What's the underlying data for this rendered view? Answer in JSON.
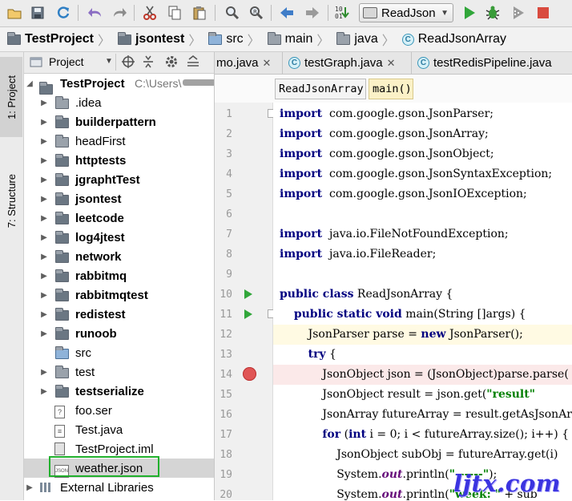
{
  "toolbar": {
    "run_config": "ReadJson",
    "icons": [
      "open-folder-icon",
      "save-icon",
      "sync-icon",
      "undo-icon",
      "redo-icon",
      "cut-icon",
      "copy-icon",
      "paste-icon",
      "find-icon",
      "replace-icon",
      "back-icon",
      "forward-icon",
      "build-icon",
      "run-icon",
      "debug-icon",
      "coverage-icon",
      "stop-icon"
    ]
  },
  "breadcrumb": [
    "TestProject",
    "jsontest",
    "src",
    "main",
    "java",
    "ReadJsonArray"
  ],
  "left_strip": {
    "project_tab": "1: Project",
    "structure_tab": "7: Structure"
  },
  "project_panel": {
    "view": "Project",
    "root": {
      "label": "TestProject",
      "path": "C:\\Users\\"
    },
    "items": [
      {
        "label": ".idea",
        "bold": false
      },
      {
        "label": "builderpattern",
        "bold": true
      },
      {
        "label": "headFirst",
        "bold": false
      },
      {
        "label": "httptests",
        "bold": true
      },
      {
        "label": "jgraphtTest",
        "bold": true
      },
      {
        "label": "jsontest",
        "bold": true
      },
      {
        "label": "leetcode",
        "bold": true
      },
      {
        "label": "log4jtest",
        "bold": true
      },
      {
        "label": "network",
        "bold": true
      },
      {
        "label": "rabbitmq",
        "bold": true
      },
      {
        "label": "rabbitmqtest",
        "bold": true
      },
      {
        "label": "redistest",
        "bold": true
      },
      {
        "label": "runoob",
        "bold": true
      },
      {
        "label": "src",
        "bold": false
      },
      {
        "label": "test",
        "bold": false
      },
      {
        "label": "testserialize",
        "bold": true
      },
      {
        "label": "foo.ser",
        "bold": false
      },
      {
        "label": "Test.java",
        "bold": false
      },
      {
        "label": "TestProject.iml",
        "bold": false
      },
      {
        "label": "weather.json",
        "bold": false
      },
      {
        "label": "External Libraries",
        "bold": false
      }
    ]
  },
  "editor_tabs": [
    {
      "label": "mo.java"
    },
    {
      "label": "testGraph.java"
    },
    {
      "label": "testRedisPipeline.java"
    }
  ],
  "editor_crumbs": [
    "ReadJsonArray",
    "main()"
  ],
  "code": {
    "line_numbers": [
      "1",
      "2",
      "3",
      "4",
      "5",
      "6",
      "7",
      "8",
      "9",
      "10",
      "11",
      "12",
      "13",
      "14",
      "15",
      "16",
      "17",
      "18",
      "19",
      "20"
    ],
    "lines": [
      [
        [
          "kw",
          "import"
        ],
        [
          "",
          "  com.google.gson.JsonParser;"
        ]
      ],
      [
        [
          "kw",
          "import"
        ],
        [
          "",
          "  com.google.gson.JsonArray;"
        ]
      ],
      [
        [
          "kw",
          "import"
        ],
        [
          "",
          "  com.google.gson.JsonObject;"
        ]
      ],
      [
        [
          "kw",
          "import"
        ],
        [
          "",
          "  com.google.gson.JsonSyntaxException;"
        ]
      ],
      [
        [
          "kw",
          "import"
        ],
        [
          "",
          "  com.google.gson.JsonIOException;"
        ]
      ],
      [],
      [
        [
          "kw",
          "import"
        ],
        [
          "",
          "  java.io.FileNotFoundException;"
        ]
      ],
      [
        [
          "kw",
          "import"
        ],
        [
          "",
          "  java.io.FileReader;"
        ]
      ],
      [],
      [
        [
          "kw",
          "public class"
        ],
        [
          "",
          " ReadJsonArray {"
        ]
      ],
      [
        [
          "",
          "    "
        ],
        [
          "kw",
          "public static void"
        ],
        [
          "",
          " main(String []args) {"
        ]
      ],
      [
        [
          "",
          "        JsonParser parse = "
        ],
        [
          "kw",
          "new"
        ],
        [
          "",
          " JsonParser();"
        ]
      ],
      [
        [
          "",
          "        "
        ],
        [
          "kw",
          "try"
        ],
        [
          "",
          " {"
        ]
      ],
      [
        [
          "",
          "            JsonObject json = (JsonObject)parse.parse("
        ]
      ],
      [
        [
          "",
          "            JsonObject result = json.get("
        ],
        [
          "str",
          "\"result\""
        ]
      ],
      [
        [
          "",
          "            JsonArray futureArray = result.getAsJsonArray("
        ]
      ],
      [
        [
          "",
          "            "
        ],
        [
          "kw",
          "for"
        ],
        [
          "",
          " ("
        ],
        [
          "kw",
          "int"
        ],
        [
          "",
          " i = 0; i < futureArray.size(); i++) {"
        ]
      ],
      [
        [
          "",
          "                JsonObject subObj = futureArray.get(i)"
        ]
      ],
      [
        [
          "",
          "                System."
        ],
        [
          "fld",
          "out"
        ],
        [
          "",
          ".println("
        ],
        [
          "str",
          "\"------\""
        ],
        [
          "",
          ");"
        ]
      ],
      [
        [
          "",
          "                System."
        ],
        [
          "fld",
          "out"
        ],
        [
          "",
          ".println("
        ],
        [
          "str",
          "\"week: \""
        ],
        [
          "",
          " + sub"
        ]
      ]
    ]
  },
  "watermark": "ljtx.com",
  "colors": {
    "current_line": "#fffae3",
    "breakpoint_line": "#fbe9e9",
    "breakpoint": "#e05555",
    "keyword": "#000080",
    "string": "#008000",
    "selection_outline": "#21b02d"
  }
}
